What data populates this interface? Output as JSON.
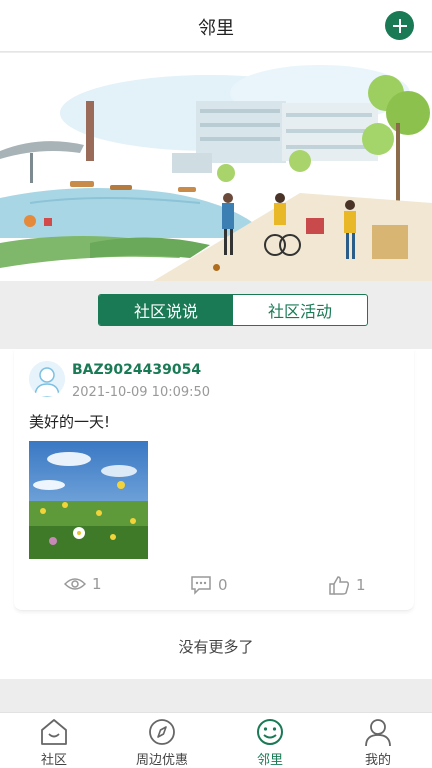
{
  "header": {
    "title": "邻里",
    "add_icon": "plus-icon"
  },
  "banner": {
    "slides": 1,
    "active_index": 0
  },
  "segments": {
    "tabs": [
      {
        "label": "社区说说",
        "active": true
      },
      {
        "label": "社区活动",
        "active": false
      }
    ]
  },
  "feed": {
    "posts": [
      {
        "username": "BAZ9024439054",
        "time": "2021-10-09 10:09:50",
        "content": "美好的一天!",
        "views": "1",
        "comments": "0",
        "likes": "1"
      }
    ],
    "no_more": "没有更多了"
  },
  "bottom_nav": {
    "items": [
      {
        "label": "社区",
        "icon": "home-icon"
      },
      {
        "label": "周边优惠",
        "icon": "compass-icon"
      },
      {
        "label": "邻里",
        "icon": "smile-icon",
        "active": true
      },
      {
        "label": "我的",
        "icon": "user-icon"
      }
    ]
  },
  "colors": {
    "brand": "#1a7a55",
    "muted": "#999999"
  }
}
